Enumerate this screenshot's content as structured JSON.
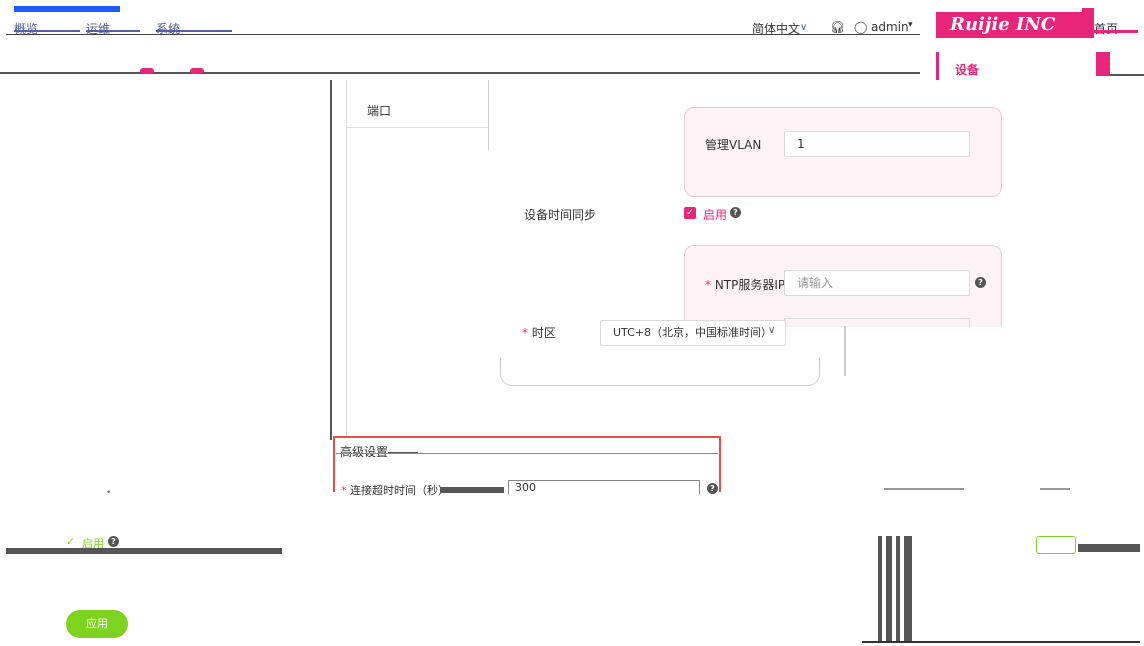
{
  "nav": {
    "items": [
      "概览",
      "运维",
      "系统"
    ],
    "language": "简体中文",
    "user": "admin",
    "brand": "Ruijie INC",
    "home": "首页"
  },
  "sidebar": {
    "device_tab": "设备"
  },
  "tabs": {
    "port": "端口"
  },
  "form": {
    "mgmt_vlan_label": "管理VLAN",
    "mgmt_vlan_value": "1",
    "time_sync_label": "设备时间同步",
    "enable_label": "启用",
    "ntp_label": "NTP服务器IP",
    "ntp_placeholder": "请输入",
    "timezone_label": "时区",
    "timezone_value": "UTC+8（北京，中国标准时间）"
  },
  "advanced": {
    "title": "高级设置",
    "timeout_label": "连接超时时间（秒）",
    "timeout_value": "300"
  },
  "bottom": {
    "enable_label": "启用",
    "apply_label": "应用"
  },
  "colors": {
    "accent": "#e9257a",
    "apply": "#7ed321",
    "highlight_border": "#e84b4b"
  }
}
